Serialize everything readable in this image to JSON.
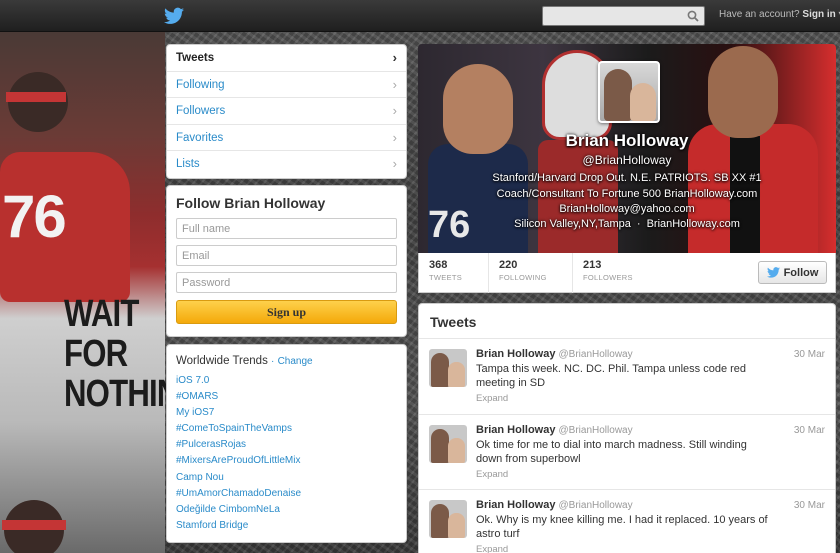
{
  "background": {
    "jersey_number": "76",
    "slogan": [
      "WAIT",
      "FOR",
      "NOTHING"
    ]
  },
  "topbar": {
    "search_placeholder": "",
    "account_prompt": "Have an account?",
    "signin_label": "Sign in",
    "signin_caret": "▾"
  },
  "nav": {
    "items": [
      {
        "label": "Tweets"
      },
      {
        "label": "Following"
      },
      {
        "label": "Followers"
      },
      {
        "label": "Favorites"
      },
      {
        "label": "Lists"
      }
    ],
    "chevron": "›"
  },
  "follow_box": {
    "title": "Follow Brian Holloway",
    "fullname_placeholder": "Full name",
    "email_placeholder": "Email",
    "password_placeholder": "Password",
    "signup_label": "Sign up"
  },
  "trends": {
    "title": "Worldwide Trends",
    "separator": "·",
    "change_label": "Change",
    "items": [
      "iOS 7.0",
      "#OMARS",
      "My iOS7",
      "#ComeToSpainTheVamps",
      "#PulcerasRojas",
      "#MixersAreProudOfLittleMix",
      "Camp Nou",
      "#UmAmorChamadoDenaise",
      "Odeğilde CimbomNeLa",
      "Stamford Bridge"
    ]
  },
  "profile": {
    "name": "Brian Holloway",
    "handle": "@BrianHolloway",
    "bio_line1": "Stanford/Harvard Drop Out. N.E. PATRIOTS. SB XX #1",
    "bio_line2": "Coach/Consultant To Fortune 500 BrianHolloway.com",
    "bio_line3": "BrianHolloway@yahoo.com",
    "location": "Silicon Valley,NY,Tampa",
    "location_sep": "·",
    "website": "BrianHolloway.com",
    "jersey_number": "76"
  },
  "stats": {
    "tweets_count": "368",
    "tweets_label": "TWEETS",
    "following_count": "220",
    "following_label": "FOLLOWING",
    "followers_count": "213",
    "followers_label": "FOLLOWERS",
    "follow_button": "Follow"
  },
  "timeline": {
    "title": "Tweets",
    "tweets": [
      {
        "name": "Brian Holloway",
        "handle": "@BrianHolloway",
        "date": "30 Mar",
        "text": "Tampa this week.  NC.  DC.  Phil. Tampa unless code red meeting in SD",
        "expand": "Expand"
      },
      {
        "name": "Brian Holloway",
        "handle": "@BrianHolloway",
        "date": "30 Mar",
        "text": "Ok time for me to dial into march madness. Still winding down from superbowl",
        "expand": "Expand"
      },
      {
        "name": "Brian Holloway",
        "handle": "@BrianHolloway",
        "date": "30 Mar",
        "text": "Ok.  Why is my knee killing me.  I had it replaced. 10 years of astro turf",
        "expand": "Expand"
      }
    ]
  },
  "colors": {
    "link_blue": "#2a8bc9",
    "signup_orange": "#f4a90a",
    "twitter_blue": "#55acee"
  }
}
